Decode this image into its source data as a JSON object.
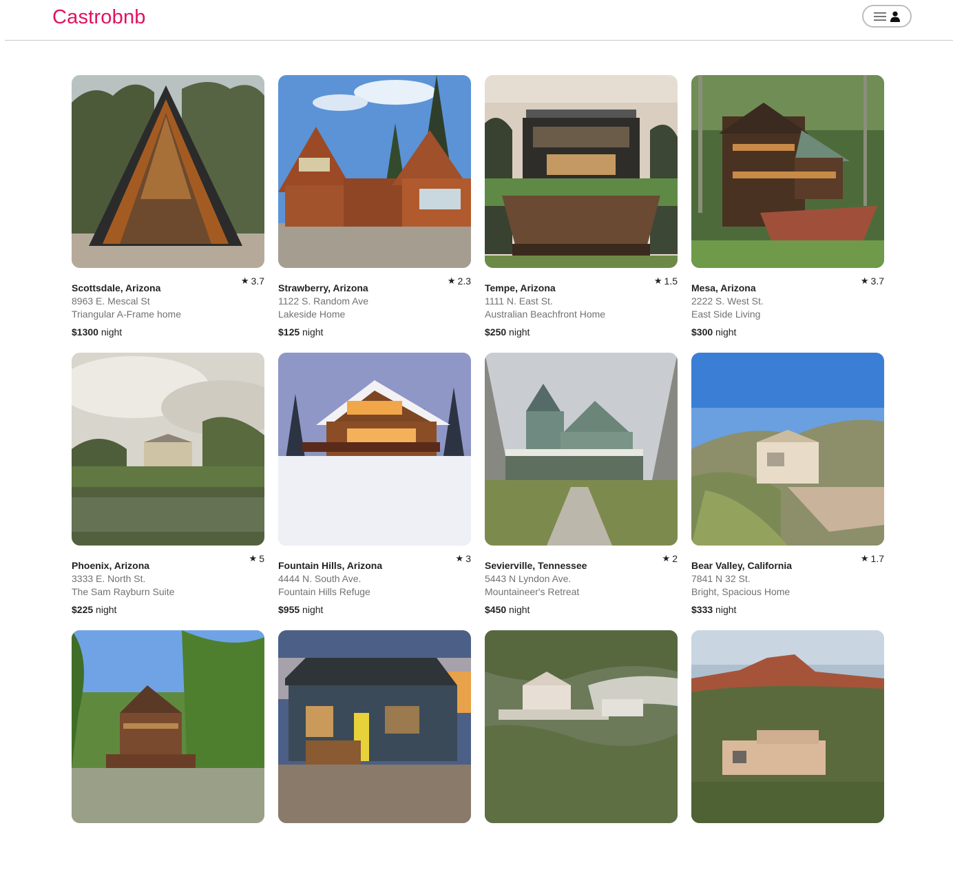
{
  "brand": {
    "name": "Castrobnb",
    "color": "#e0115f"
  },
  "header": {
    "menu_icon": "hamburger-icon",
    "user_icon": "user-icon"
  },
  "listings": [
    {
      "location": "Scottsdale, Arizona",
      "address": "8963 E. Mescal St",
      "title": "Triangular A-Frame home",
      "price": "$1300",
      "unit": "night",
      "rating": "3.7"
    },
    {
      "location": "Strawberry, Arizona",
      "address": "1122 S. Random Ave",
      "title": "Lakeside Home",
      "price": "$125",
      "unit": "night",
      "rating": "2.3"
    },
    {
      "location": "Tempe, Arizona",
      "address": "1111 N. East St.",
      "title": "Australian Beachfront Home",
      "price": "$250",
      "unit": "night",
      "rating": "1.5"
    },
    {
      "location": "Mesa, Arizona",
      "address": "2222 S. West St.",
      "title": "East Side Living",
      "price": "$300",
      "unit": "night",
      "rating": "3.7"
    },
    {
      "location": "Phoenix, Arizona",
      "address": "3333 E. North St.",
      "title": "The Sam Rayburn Suite",
      "price": "$225",
      "unit": "night",
      "rating": "5"
    },
    {
      "location": "Fountain Hills, Arizona",
      "address": "4444 N. South Ave.",
      "title": "Fountain Hills Refuge",
      "price": "$955",
      "unit": "night",
      "rating": "3"
    },
    {
      "location": "Sevierville, Tennessee",
      "address": "5443 N Lyndon Ave.",
      "title": "Mountaineer's Retreat",
      "price": "$450",
      "unit": "night",
      "rating": "2"
    },
    {
      "location": "Bear Valley, California",
      "address": "7841 N 32 St.",
      "title": "Bright, Spacious Home",
      "price": "$333",
      "unit": "night",
      "rating": "1.7"
    },
    {
      "location": "",
      "address": "",
      "title": "",
      "price": "",
      "unit": "",
      "rating": ""
    },
    {
      "location": "",
      "address": "",
      "title": "",
      "price": "",
      "unit": "",
      "rating": ""
    },
    {
      "location": "",
      "address": "",
      "title": "",
      "price": "",
      "unit": "",
      "rating": ""
    },
    {
      "location": "",
      "address": "",
      "title": "",
      "price": "",
      "unit": "",
      "rating": ""
    }
  ]
}
